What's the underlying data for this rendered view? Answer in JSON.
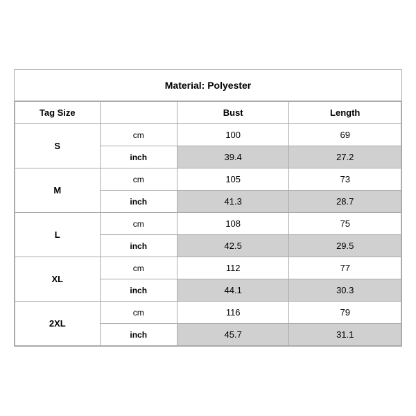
{
  "title": "Material: Polyester",
  "headers": {
    "tag_size": "Tag Size",
    "bust": "Bust",
    "length": "Length"
  },
  "sizes": [
    {
      "tag": "S",
      "cm": {
        "bust": "100",
        "length": "69"
      },
      "inch": {
        "bust": "39.4",
        "length": "27.2"
      }
    },
    {
      "tag": "M",
      "cm": {
        "bust": "105",
        "length": "73"
      },
      "inch": {
        "bust": "41.3",
        "length": "28.7"
      }
    },
    {
      "tag": "L",
      "cm": {
        "bust": "108",
        "length": "75"
      },
      "inch": {
        "bust": "42.5",
        "length": "29.5"
      }
    },
    {
      "tag": "XL",
      "cm": {
        "bust": "112",
        "length": "77"
      },
      "inch": {
        "bust": "44.1",
        "length": "30.3"
      }
    },
    {
      "tag": "2XL",
      "cm": {
        "bust": "116",
        "length": "79"
      },
      "inch": {
        "bust": "45.7",
        "length": "31.1"
      }
    }
  ],
  "units": {
    "cm": "cm",
    "inch": "inch"
  }
}
